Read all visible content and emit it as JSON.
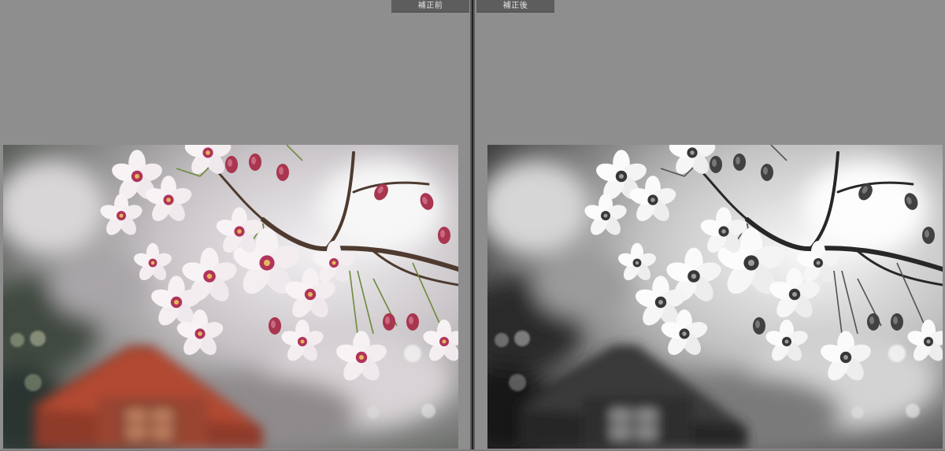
{
  "compare_view": {
    "before_label": "補正前",
    "after_label": "補正後"
  },
  "colors": {
    "background": "#8e8e8e",
    "label_bg": "#5d5d5d",
    "label_text": "#e4e4e4",
    "divider": "#222222"
  }
}
